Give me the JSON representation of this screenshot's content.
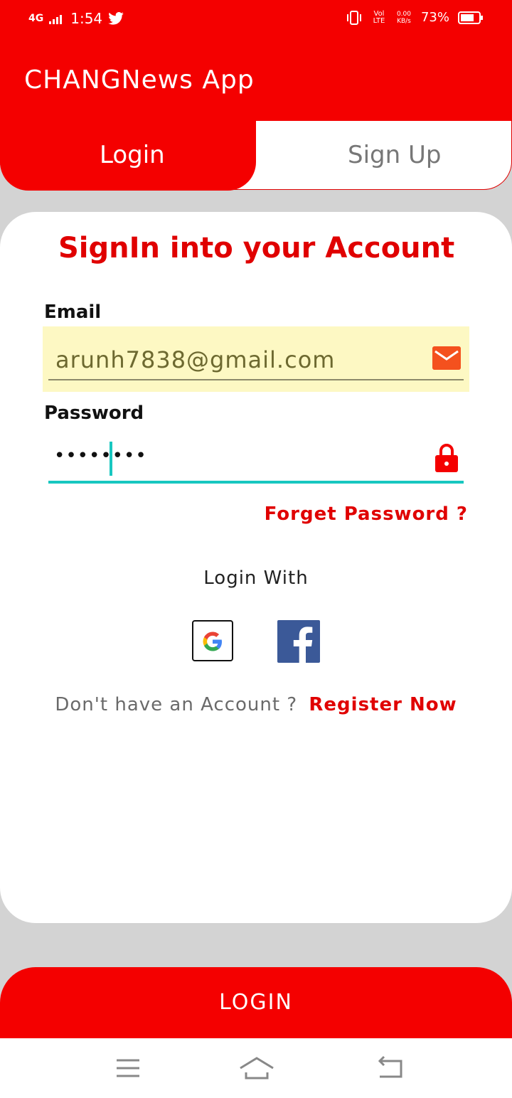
{
  "status_bar": {
    "network": "4G",
    "time": "1:54",
    "volte": "Vol LTE",
    "data_rate": "0.00 KB/s",
    "battery": "73%"
  },
  "app": {
    "title": "CHANGNews App"
  },
  "tabs": {
    "login": "Login",
    "signup": "Sign Up"
  },
  "form": {
    "heading": "SignIn into your Account",
    "email_label": "Email",
    "email_value": "arunh7838@gmail.com",
    "password_label": "Password",
    "password_value": "••••••••",
    "forget_password": "Forget Password ?",
    "login_with": "Login With",
    "no_account": "Don't have an Account ?",
    "register_now": "Register Now"
  },
  "actions": {
    "login_button": "LOGIN"
  },
  "colors": {
    "accent": "#f40000",
    "cursor": "#18c7c0",
    "email_bg": "#fdf8c3",
    "facebook": "#3b5998"
  }
}
